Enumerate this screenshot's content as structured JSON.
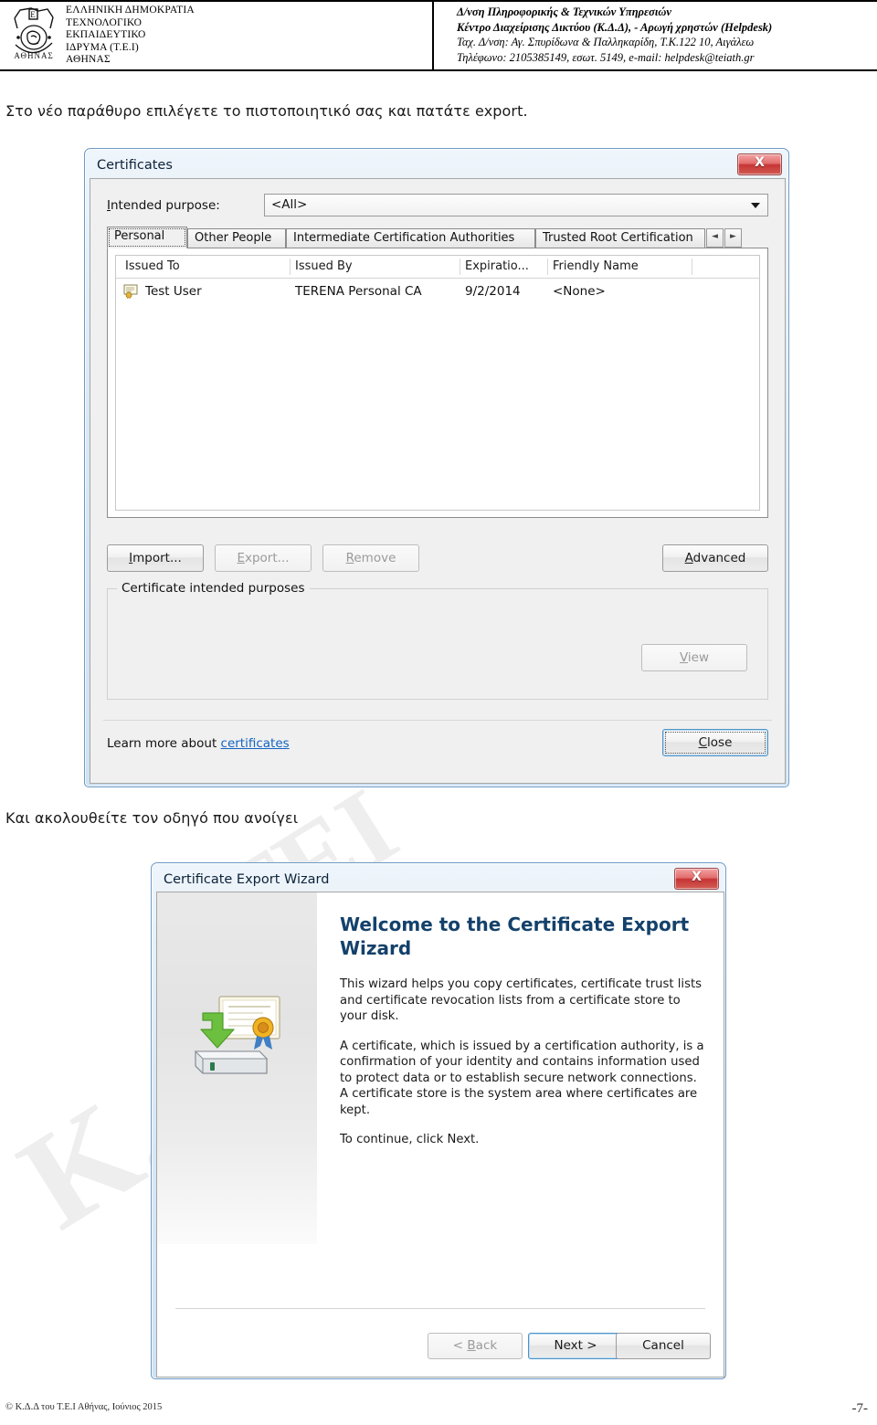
{
  "header": {
    "org_lines": [
      "ΕΛΛΗΝΙΚΗ ΔΗΜΟΚΡΑΤΙΑ",
      "ΤΕΧΝΟΛΟΓΙΚΟ",
      "ΕΚΠΑΙΔΕΥΤΙΚΟ",
      "ΙΔΡΥΜΑ (Τ.Ε.Ι)",
      "ΑΘΗΝΑΣ"
    ],
    "dept_line1": "Δ/νση Πληροφορικής & Τεχνικών Υπηρεσιών",
    "dept_line2": "Κέντρο Διαχείρισης Δικτύου (Κ.Δ.Δ), - Αρωγή χρηστών (Helpdesk)",
    "dept_line3": "Ταχ. Δ/νση: Αγ. Σπυρίδωνα & Παλληκαρίδη, Τ.Κ.122 10, Αιγάλεω",
    "dept_line4": "Τηλέφωνο: 2105385149, εσωτ. 5149,  e-mail: helpdesk@teiath.gr",
    "logo_text_top": "ΤΕΙ",
    "logo_text_bottom": "ΑΘΗΝΑΣ"
  },
  "instructions": {
    "first": "Στο νέο παράθυρο επιλέγετε το πιστοποιητικό σας και πατάτε export.",
    "second": "Και ακολουθείτε τον οδηγό που ανοίγει"
  },
  "certificates_dialog": {
    "title": "Certificates",
    "close_glyph": "X",
    "intended_purpose_label": "Intended purpose:",
    "intended_purpose_value": "<All>",
    "tabs": [
      {
        "label": "Personal",
        "selected": true
      },
      {
        "label": "Other People",
        "selected": false
      },
      {
        "label": "Intermediate Certification Authorities",
        "selected": false
      },
      {
        "label": "Trusted Root Certification",
        "selected": false
      }
    ],
    "tab_scroll_left": "◄",
    "tab_scroll_right": "►",
    "columns": [
      "Issued To",
      "Issued By",
      "Expiratio...",
      "Friendly Name"
    ],
    "rows": [
      {
        "issued_to": "Test User",
        "issued_by": "TERENA Personal CA",
        "expiration": "9/2/2014",
        "friendly_name": "<None>"
      }
    ],
    "buttons": {
      "import": "Import...",
      "export": "Export...",
      "remove": "Remove",
      "advanced": "Advanced",
      "view": "View",
      "close": "Close"
    },
    "group_label": "Certificate intended purposes",
    "learn_more_prefix": "Learn more about ",
    "learn_more_link": "certificates"
  },
  "wizard_dialog": {
    "title": "Certificate Export Wizard",
    "close_glyph": "X",
    "heading": "Welcome to the Certificate Export Wizard",
    "paragraph1": "This wizard helps you copy certificates, certificate trust lists and certificate revocation lists from a certificate store to your disk.",
    "paragraph2": "A certificate, which is issued by a certification authority, is a confirmation of your identity and contains information used to protect data or to establish secure network connections. A certificate store is the system area where certificates are kept.",
    "paragraph3": "To continue, click Next.",
    "buttons": {
      "back": "< Back",
      "next": "Next >",
      "cancel": "Cancel"
    }
  },
  "footer": {
    "copyright": "© Κ.Δ.Δ του Τ.Ε.Ι Αθήνας, Ιούνιος  2015",
    "page_number": "-7-"
  },
  "watermarks": {
    "w1": "ΤΕΙ",
    "w2": "ΤΕΙ",
    "w3": "Κ.Δ.Δ"
  },
  "colors": {
    "accent_blue": "#4d94c7",
    "link_blue": "#1263c2",
    "close_red": "#c63535",
    "heading_blue": "#14416b"
  }
}
